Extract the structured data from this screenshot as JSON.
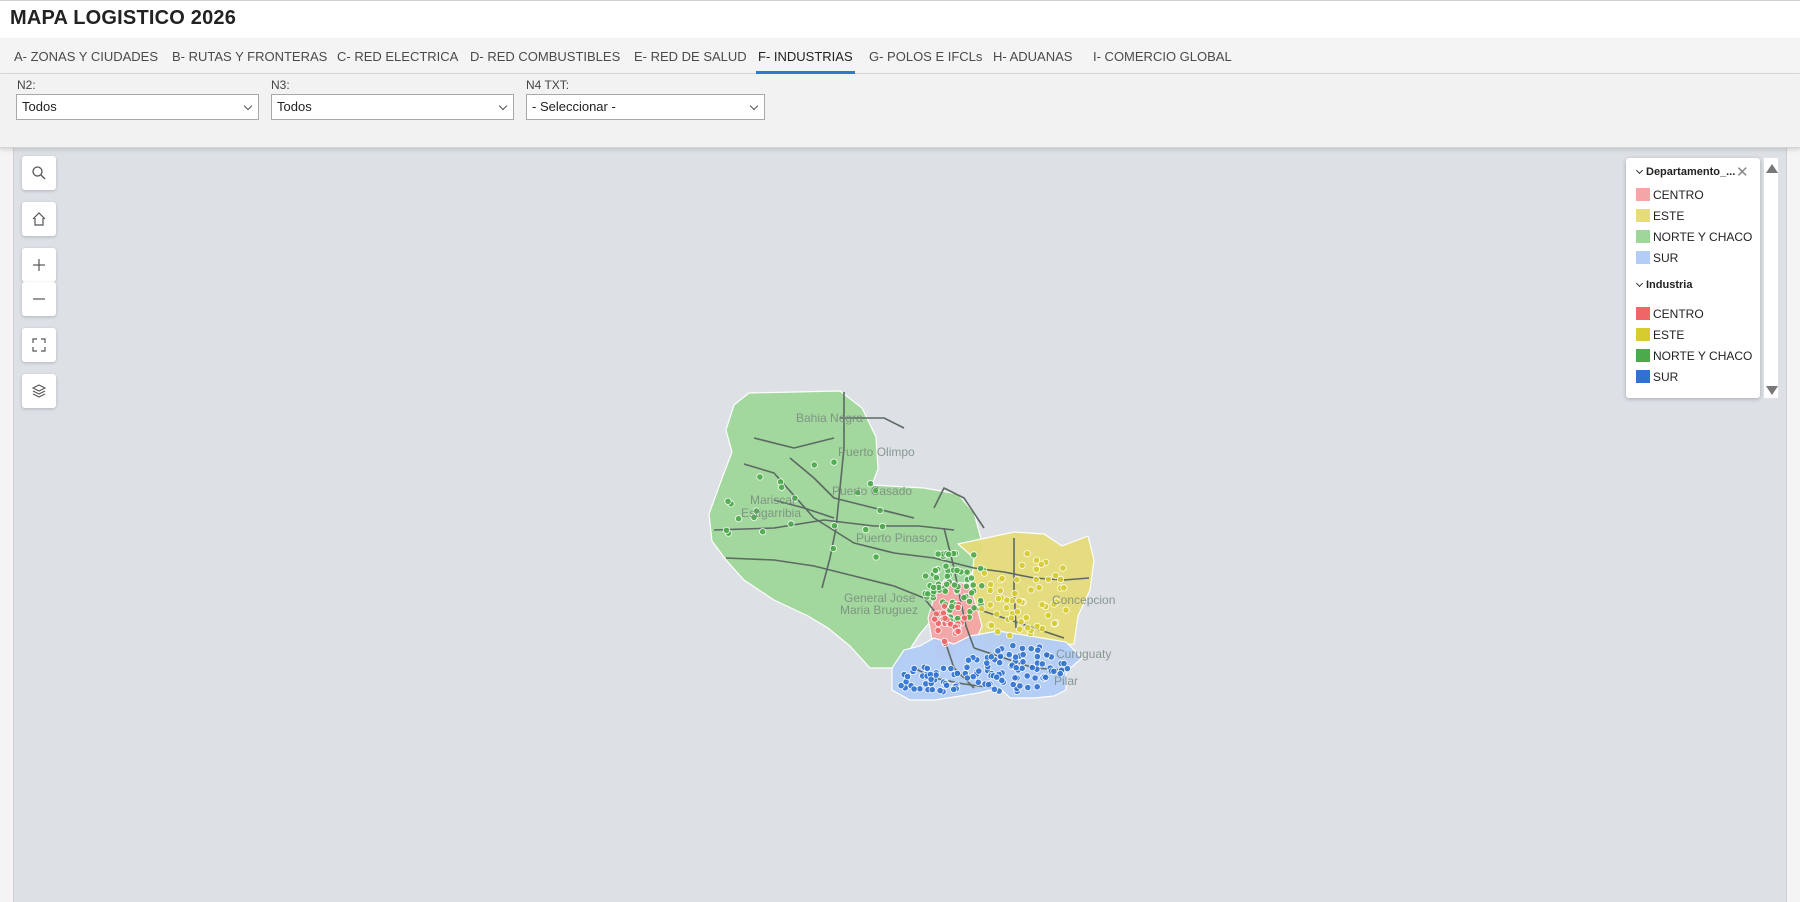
{
  "app": {
    "title": "MAPA LOGISTICO 2026"
  },
  "tabs": [
    {
      "label": "A- ZONAS Y CIUDADES"
    },
    {
      "label": "B- RUTAS Y FRONTERAS"
    },
    {
      "label": "C- RED ELECTRICA"
    },
    {
      "label": "D- RED COMBUSTIBLES"
    },
    {
      "label": "E- RED DE SALUD"
    },
    {
      "label": "F- INDUSTRIAS",
      "active": true
    },
    {
      "label": "G- POLOS E IFCLs"
    },
    {
      "label": "H- ADUANAS"
    },
    {
      "label": "I- COMERCIO GLOBAL"
    }
  ],
  "filters": {
    "n2": {
      "label": "N2:",
      "value": "Todos"
    },
    "n3": {
      "label": "N3:",
      "value": "Todos"
    },
    "n4": {
      "label": "N4 TXT:",
      "value": "- Seleccionar -"
    }
  },
  "map_tools": [
    {
      "name": "search-icon"
    },
    {
      "name": "home-icon"
    },
    {
      "name": "zoom-in-icon"
    },
    {
      "name": "zoom-out-icon"
    },
    {
      "name": "fullscreen-icon"
    },
    {
      "name": "layers-icon"
    }
  ],
  "legend": {
    "group1": {
      "title": "Departamento_...",
      "items": [
        {
          "label": "CENTRO",
          "color": "#f4a6a6"
        },
        {
          "label": "ESTE",
          "color": "#e6dc7a"
        },
        {
          "label": "NORTE Y CHACO",
          "color": "#9fd79a"
        },
        {
          "label": "SUR",
          "color": "#b3cdf6"
        }
      ]
    },
    "group2": {
      "title": "Industria",
      "items": [
        {
          "label": "CENTRO",
          "color": "#f06666"
        },
        {
          "label": "ESTE",
          "color": "#d6cc30"
        },
        {
          "label": "NORTE Y CHACO",
          "color": "#4caa4c"
        },
        {
          "label": "SUR",
          "color": "#2f72d0"
        }
      ]
    }
  },
  "map_labels": [
    {
      "text": "Bahia Negra"
    },
    {
      "text": "Puerto Olimpo"
    },
    {
      "text": "Puerto Casado"
    },
    {
      "text": "Mariscal"
    },
    {
      "text": "Estigarribia"
    },
    {
      "text": "Puerto Pinasco"
    },
    {
      "text": "General Jose"
    },
    {
      "text": "Maria Bruguez"
    },
    {
      "text": "Concepcion"
    },
    {
      "text": "Curuguaty"
    },
    {
      "text": "Pilar"
    }
  ]
}
